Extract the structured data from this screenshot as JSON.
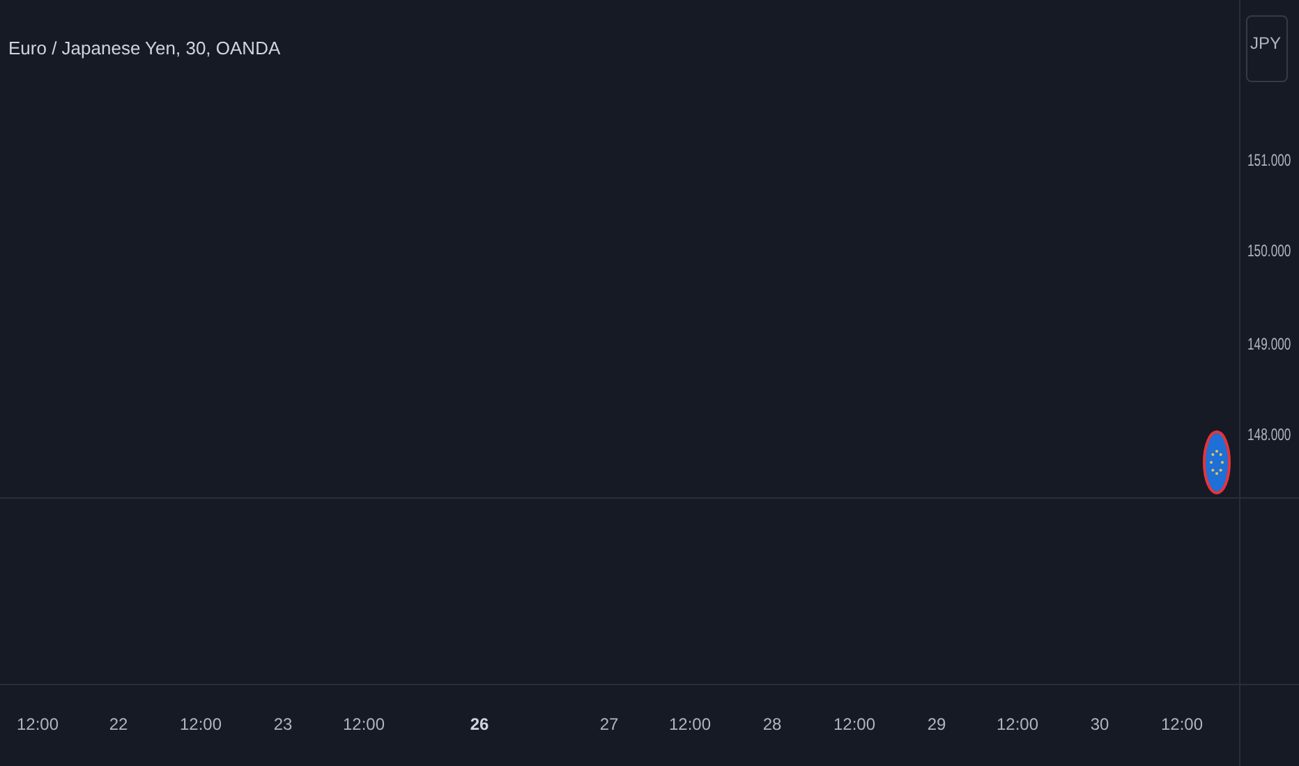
{
  "chart": {
    "title": "Euro / Japanese Yen, 30, OANDA"
  },
  "price_axis": {
    "currency": "JPY",
    "labels": [
      "151.000",
      "150.000",
      "149.000",
      "148.000"
    ]
  },
  "time_axis": {
    "labels": [
      {
        "text": "12:00",
        "major": false
      },
      {
        "text": "22",
        "major": false
      },
      {
        "text": "12:00",
        "major": false
      },
      {
        "text": "23",
        "major": false
      },
      {
        "text": "12:00",
        "major": false
      },
      {
        "text": "26",
        "major": true
      },
      {
        "text": "27",
        "major": false
      },
      {
        "text": "12:00",
        "major": false
      },
      {
        "text": "28",
        "major": false
      },
      {
        "text": "12:00",
        "major": false
      },
      {
        "text": "29",
        "major": false
      },
      {
        "text": "12:00",
        "major": false
      },
      {
        "text": "30",
        "major": false
      },
      {
        "text": "12:00",
        "major": false
      }
    ]
  }
}
